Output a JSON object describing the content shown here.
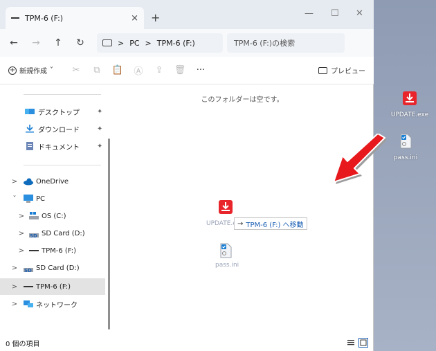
{
  "window": {
    "tab_title": "TPM-6 (F:)",
    "tab_close": "×",
    "new_tab": "+",
    "minimize": "—",
    "maximize": "☐",
    "close": "✕"
  },
  "navbar": {
    "back": "←",
    "forward": "→",
    "up": "↑",
    "refresh": "↻",
    "crumbs": [
      "PC",
      "TPM-6 (F:)"
    ],
    "crumb_sep": ">",
    "search_placeholder": "TPM-6 (F:)の検索"
  },
  "toolbar": {
    "new_label": "新規作成",
    "new_chevron": "˅",
    "more": "···",
    "preview_label": "プレビュー",
    "icons": [
      "cut-icon",
      "copy-icon",
      "paste-icon",
      "rename-icon",
      "share-icon",
      "delete-icon"
    ]
  },
  "sidebar": {
    "quick_access": [
      {
        "label": "デスクトップ",
        "icon": "desktop-folder-icon",
        "pin": "✦"
      },
      {
        "label": "ダウンロード",
        "icon": "download-icon",
        "pin": "✦"
      },
      {
        "label": "ドキュメント",
        "icon": "document-icon",
        "pin": "✦"
      }
    ],
    "tree": [
      {
        "label": "OneDrive",
        "chevron": ">",
        "icon": "cloud-icon"
      },
      {
        "label": "PC",
        "chevron": "˅",
        "icon": "pc-icon"
      },
      {
        "label": "OS (C:)",
        "chevron": ">",
        "icon": "os-drive-icon"
      },
      {
        "label": "SD Card (D:)",
        "chevron": ">",
        "icon": "sd-card-icon"
      },
      {
        "label": "TPM-6 (F:)",
        "chevron": ">",
        "icon": "drive-icon"
      },
      {
        "label": "SD Card (D:)",
        "chevron": ">",
        "icon": "sd-card-icon"
      },
      {
        "label": "TPM-6 (F:)",
        "chevron": ">",
        "icon": "drive-icon",
        "selected": true
      },
      {
        "label": "ネットワーク",
        "chevron": ">",
        "icon": "network-icon"
      }
    ]
  },
  "content": {
    "empty_message": "このフォルダーは空です。",
    "drag_file_1": "UPDATE.exe",
    "drag_file_2": "pass.ini",
    "move_arrow": "→",
    "move_tooltip": "TPM-6 (F:) へ移動"
  },
  "status": {
    "item_count": "0 個の項目"
  },
  "desktop": {
    "items": [
      {
        "label": "UPDATE.exe",
        "icon": "update-exe-icon"
      },
      {
        "label": "pass.ini",
        "icon": "ini-file-icon"
      }
    ]
  },
  "colors": {
    "accent": "#1a5fb4",
    "arrow": "#e8191c"
  }
}
